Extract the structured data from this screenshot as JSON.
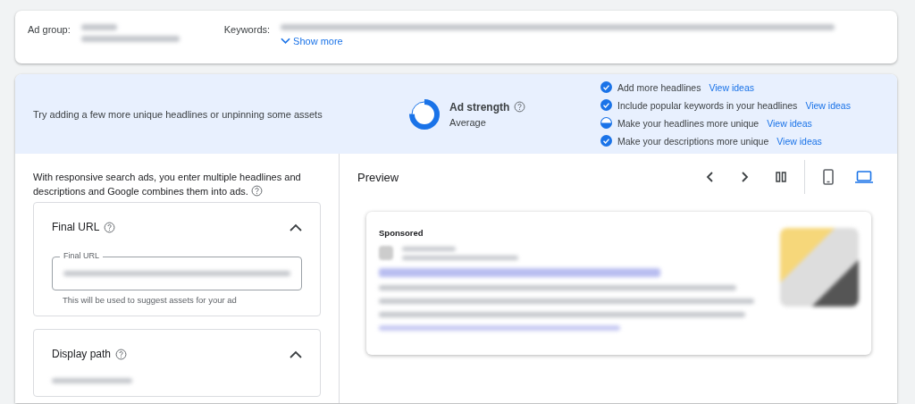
{
  "summary": {
    "ad_group_label": "Ad group:",
    "keywords_label": "Keywords:",
    "show_more": "Show more"
  },
  "strength_banner": {
    "tip": "Try adding a few more unique headlines or unpinning some assets",
    "title": "Ad strength",
    "rating": "Average",
    "level": 0.75,
    "checklist": [
      {
        "text": "Add more headlines",
        "link": "View ideas",
        "kind": "done"
      },
      {
        "text": "Include popular keywords in your headlines",
        "link": "View ideas",
        "kind": "done"
      },
      {
        "text": "Make your headlines more unique",
        "link": "View ideas",
        "kind": "partial"
      },
      {
        "text": "Make your descriptions more unique",
        "link": "View ideas",
        "kind": "done"
      }
    ]
  },
  "intro": "With responsive search ads, you enter multiple headlines and descriptions and Google combines them into ads.",
  "sections": [
    {
      "title": "Final URL",
      "expanded": true,
      "kind": "url",
      "field_label": "Final URL",
      "hint": "This will be used to suggest assets for your ad"
    },
    {
      "title": "Display path",
      "expanded": true,
      "kind": "path"
    }
  ],
  "preview": {
    "title": "Preview",
    "devices": [
      {
        "kind": "mobile",
        "selected": false
      },
      {
        "kind": "desktop",
        "selected": true
      }
    ],
    "ad": {
      "label": "Sponsored"
    }
  }
}
